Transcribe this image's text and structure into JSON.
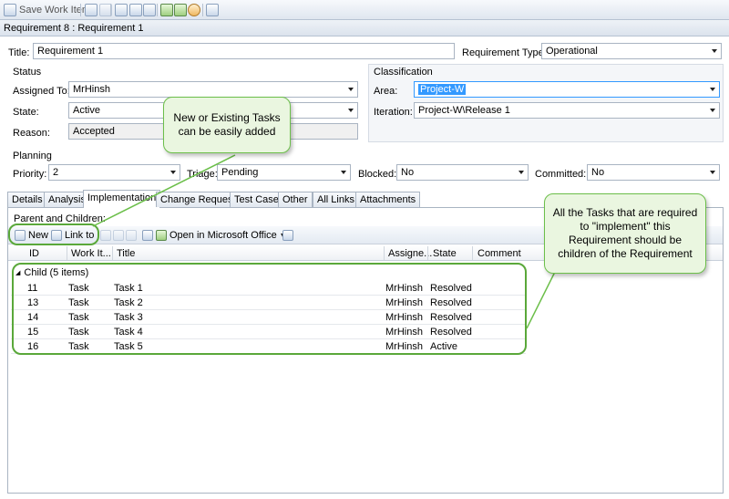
{
  "toolbar": {
    "save_label": "Save Work Item"
  },
  "title_bar": "Requirement 8 : Requirement 1",
  "form": {
    "title_label": "Title:",
    "title_value": "Requirement 1",
    "req_type_label": "Requirement Type:",
    "req_type_value": "Operational",
    "status": {
      "heading": "Status",
      "assigned_label": "Assigned To:",
      "assigned_value": "MrHinsh",
      "state_label": "State:",
      "state_value": "Active",
      "reason_label": "Reason:",
      "reason_value": "Accepted"
    },
    "classification": {
      "heading": "Classification",
      "area_label": "Area:",
      "area_value": "Project-W",
      "iteration_label": "Iteration:",
      "iteration_value": "Project-W\\Release 1"
    },
    "planning": {
      "heading": "Planning",
      "priority_label": "Priority:",
      "priority_value": "2",
      "triage_label": "Triage:",
      "triage_value": "Pending",
      "blocked_label": "Blocked:",
      "blocked_value": "No",
      "committed_label": "Committed:",
      "committed_value": "No"
    }
  },
  "tabs": [
    "Details",
    "Analysis",
    "Implementation",
    "Change Requests",
    "Test Cases",
    "Other",
    "All Links",
    "Attachments"
  ],
  "implementation": {
    "section_label": "Parent and Children:",
    "new_label": "New",
    "link_label": "Link to",
    "office_label": "Open in Microsoft Office",
    "columns": {
      "id": "ID",
      "type": "Work It...",
      "title": "Title",
      "assigned": "Assigne...",
      "state": "State",
      "comment": "Comment"
    },
    "group_label": "Child (5 items)",
    "rows": [
      {
        "id": "11",
        "type": "Task",
        "title": "Task 1",
        "assigned": "MrHinsh",
        "state": "Resolved"
      },
      {
        "id": "13",
        "type": "Task",
        "title": "Task 2",
        "assigned": "MrHinsh",
        "state": "Resolved"
      },
      {
        "id": "14",
        "type": "Task",
        "title": "Task 3",
        "assigned": "MrHinsh",
        "state": "Resolved"
      },
      {
        "id": "15",
        "type": "Task",
        "title": "Task 4",
        "assigned": "MrHinsh",
        "state": "Resolved"
      },
      {
        "id": "16",
        "type": "Task",
        "title": "Task 5",
        "assigned": "MrHinsh",
        "state": "Active"
      }
    ]
  },
  "callouts": {
    "left": "New or Existing Tasks can be easily added",
    "right": "All the Tasks that are required to \"implement\" this Requirement should be children of the Requirement"
  },
  "colors": {
    "highlight": "#5aa83a",
    "callout_bg": "#eaf6e0",
    "selection": "#3399ff"
  }
}
